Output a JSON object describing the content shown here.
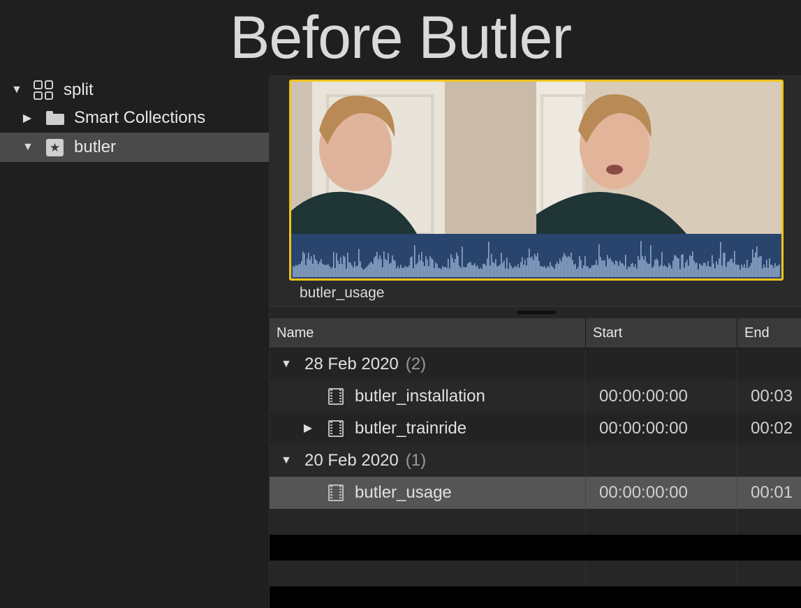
{
  "title": "Before Butler",
  "sidebar": {
    "library": {
      "label": "split",
      "disclosure": "▼",
      "icon": "library-icon"
    },
    "items": [
      {
        "label": "Smart Collections",
        "disclosure": "▶",
        "icon": "folder-icon"
      },
      {
        "label": "butler",
        "disclosure": "▼",
        "icon": "event-star-icon",
        "selected": true
      }
    ]
  },
  "preview": {
    "clip_name": "butler_usage",
    "highlight_color": "#f0c419",
    "waveform_color": "#29456e"
  },
  "list": {
    "columns": [
      "Name",
      "Start",
      "End"
    ],
    "groups": [
      {
        "date": "28 Feb 2020",
        "count": "(2)",
        "clips": [
          {
            "name": "butler_installation",
            "start": "00:00:00:00",
            "end": "00:03"
          },
          {
            "name": "butler_trainride",
            "start": "00:00:00:00",
            "end": "00:02",
            "disclosure": "▶"
          }
        ]
      },
      {
        "date": "20 Feb 2020",
        "count": "(1)",
        "clips": [
          {
            "name": "butler_usage",
            "start": "00:00:00:00",
            "end": "00:01",
            "selected": true
          }
        ]
      }
    ],
    "group_disclosure": "▼"
  }
}
